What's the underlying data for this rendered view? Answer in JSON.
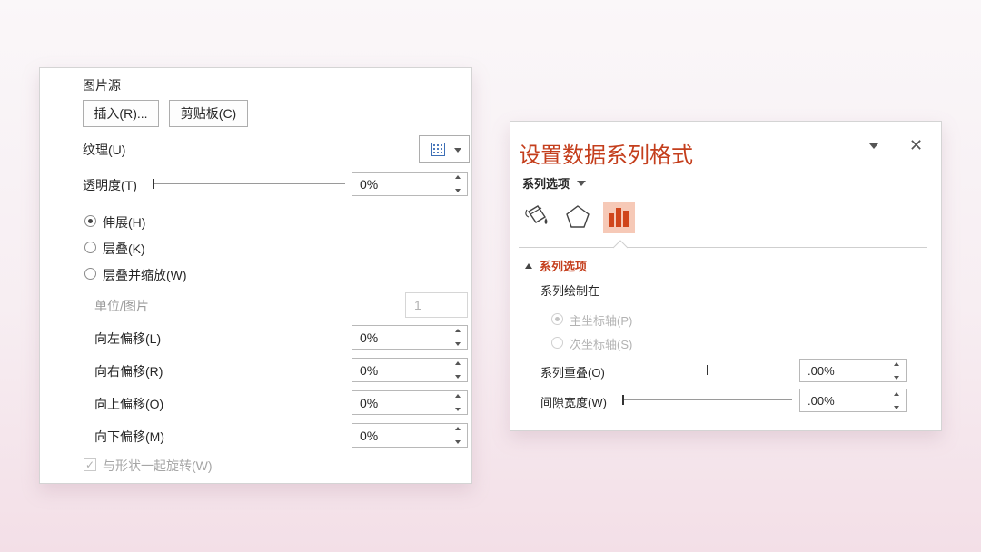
{
  "left_panel": {
    "picture_source_label": "图片源",
    "insert_button": "插入(R)...",
    "clipboard_button": "剪贴板(C)",
    "texture_label": "纹理(U)",
    "transparency_label": "透明度(T)",
    "transparency_value": "0%",
    "radio_stretch": "伸展(H)",
    "radio_tile": "层叠(K)",
    "radio_tile_scale": "层叠并缩放(W)",
    "units_per_picture_label": "单位/图片",
    "units_per_picture_value": "1",
    "offset_left_label": "向左偏移(L)",
    "offset_left_value": "0%",
    "offset_right_label": "向右偏移(R)",
    "offset_right_value": "0%",
    "offset_top_label": "向上偏移(O)",
    "offset_top_value": "0%",
    "offset_bottom_label": "向下偏移(M)",
    "offset_bottom_value": "0%",
    "rotate_with_shape_label": "与形状一起旋转(W)",
    "rotate_with_shape_checked": true
  },
  "right_panel": {
    "title": "设置数据系列格式",
    "series_options_dropdown": "系列选项",
    "section_title": "系列选项",
    "plot_series_on_label": "系列绘制在",
    "primary_axis_label": "主坐标轴(P)",
    "secondary_axis_label": "次坐标轴(S)",
    "series_overlap_label": "系列重叠(O)",
    "series_overlap_value": ".00%",
    "gap_width_label": "间隙宽度(W)",
    "gap_width_value": ".00%",
    "accent_color": "#c43e1c",
    "active_tab_color": "#f6c9b7"
  }
}
